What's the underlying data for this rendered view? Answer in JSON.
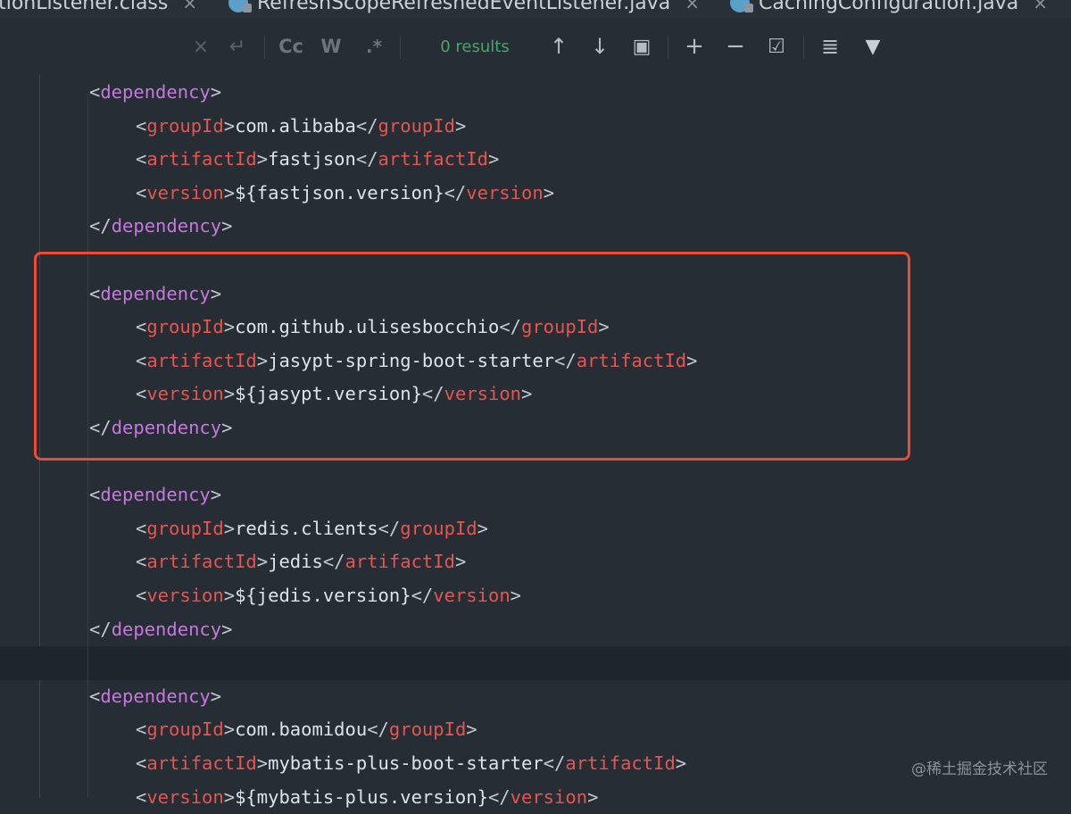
{
  "tabs": [
    {
      "label": "itionListener.class",
      "close": "×"
    },
    {
      "label": "RefreshScopeRefreshedEventListener.java",
      "close": "×"
    },
    {
      "label": "CachingConfiguration.java",
      "close": "×"
    }
  ],
  "findbar": {
    "clear_icon": "×",
    "replace_icon": "↵",
    "match_case": "Cc",
    "words": "W",
    "regex": ".*",
    "results": "0 results",
    "prev_icon": "↑",
    "next_icon": "↓",
    "open_in_window_icon": "▣",
    "add_occurrence_icon": "+",
    "remove_occurrence_icon": "−",
    "select_all_icon": "☑",
    "more_icon": "≣",
    "filter_icon": "▼"
  },
  "code": [
    {
      "indent": 1,
      "kind": "open",
      "tag": "dependency"
    },
    {
      "indent": 2,
      "kind": "elem",
      "tag": "groupId",
      "value": "com.alibaba"
    },
    {
      "indent": 2,
      "kind": "elem",
      "tag": "artifactId",
      "value": "fastjson"
    },
    {
      "indent": 2,
      "kind": "elem",
      "tag": "version",
      "value": "${fastjson.version}"
    },
    {
      "indent": 1,
      "kind": "close",
      "tag": "dependency"
    },
    {
      "indent": 0,
      "kind": "blank"
    },
    {
      "indent": 1,
      "kind": "open",
      "tag": "dependency"
    },
    {
      "indent": 2,
      "kind": "elem",
      "tag": "groupId",
      "value": "com.github.ulisesbocchio"
    },
    {
      "indent": 2,
      "kind": "elem",
      "tag": "artifactId",
      "value": "jasypt-spring-boot-starter"
    },
    {
      "indent": 2,
      "kind": "elem",
      "tag": "version",
      "value": "${jasypt.version}"
    },
    {
      "indent": 1,
      "kind": "close",
      "tag": "dependency"
    },
    {
      "indent": 0,
      "kind": "blank"
    },
    {
      "indent": 1,
      "kind": "open",
      "tag": "dependency"
    },
    {
      "indent": 2,
      "kind": "elem",
      "tag": "groupId",
      "value": "redis.clients"
    },
    {
      "indent": 2,
      "kind": "elem",
      "tag": "artifactId",
      "value": "jedis"
    },
    {
      "indent": 2,
      "kind": "elem",
      "tag": "version",
      "value": "${jedis.version}"
    },
    {
      "indent": 1,
      "kind": "close",
      "tag": "dependency"
    },
    {
      "indent": 0,
      "kind": "blank",
      "current": true
    },
    {
      "indent": 1,
      "kind": "open",
      "tag": "dependency"
    },
    {
      "indent": 2,
      "kind": "elem",
      "tag": "groupId",
      "value": "com.baomidou"
    },
    {
      "indent": 2,
      "kind": "elem",
      "tag": "artifactId",
      "value": "mybatis-plus-boot-starter"
    },
    {
      "indent": 2,
      "kind": "elem",
      "tag": "version",
      "value": "${mybatis-plus.version}"
    }
  ],
  "watermark": "@稀土掘金技术社区",
  "colors": {
    "background": "#262d35",
    "tag": "#e4564f",
    "dependency_tag": "#c678dd",
    "bracket": "#c3c9d1",
    "text": "#dde3ea",
    "highlight_box": "#e94b35",
    "results": "#4aa56a"
  }
}
